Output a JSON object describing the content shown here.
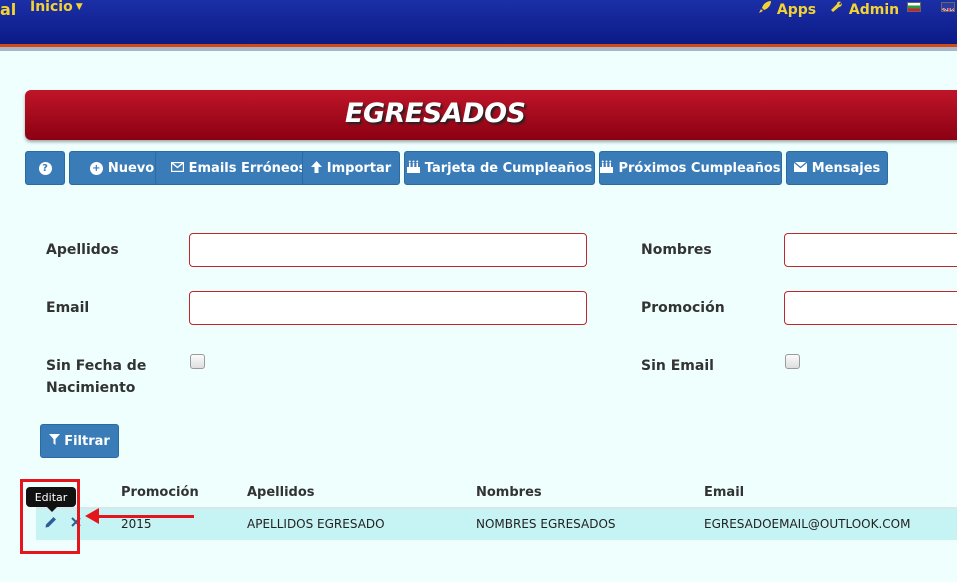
{
  "navbar": {
    "brand_fragment": "al",
    "inicio_label": "Inicio",
    "apps_label": "Apps",
    "admin_label": "Admin"
  },
  "page": {
    "title": "EGRESADOS"
  },
  "toolbar": {
    "help_label": "?",
    "nuevo_label": "Nuevo",
    "emails_erroneos_label": "Emails Erróneos",
    "importar_label": "Importar",
    "tarjeta_label": "Tarjeta de Cumpleaños",
    "proximos_label": "Próximos Cumpleaños",
    "mensajes_label": "Mensajes"
  },
  "filters": {
    "apellidos_label": "Apellidos",
    "apellidos_value": "",
    "nombres_label": "Nombres",
    "nombres_value": "",
    "email_label": "Email",
    "email_value": "",
    "promocion_label": "Promoción",
    "promocion_value": "",
    "sin_fecha_label_1": "Sin Fecha de",
    "sin_fecha_label_2": "Nacimiento",
    "sin_fecha_checked": false,
    "sin_email_label": "Sin Email",
    "sin_email_checked": false,
    "filtrar_label": "Filtrar"
  },
  "table": {
    "columns": [
      "Promoción",
      "Apellidos",
      "Nombres",
      "Email"
    ],
    "rows": [
      {
        "promocion": "2015",
        "apellidos": "APELLIDOS EGRESADO",
        "nombres": "NOMBRES EGRESADOS",
        "email": "EGRESADOEMAIL@OUTLOOK.COM"
      }
    ]
  },
  "tooltip": {
    "text": "Editar"
  },
  "colors": {
    "navbar": "#0b1a86",
    "nav_text": "#f4d232",
    "banner": "#a80c1e",
    "button": "#3a7cb8",
    "row_highlight": "#c6f3f4",
    "annotation": "#e5161b"
  },
  "icons": {
    "rocket": "rocket-icon",
    "wrench": "wrench-icon",
    "edit": "pencil-icon",
    "delete": "times-icon",
    "filter": "filter-icon"
  }
}
